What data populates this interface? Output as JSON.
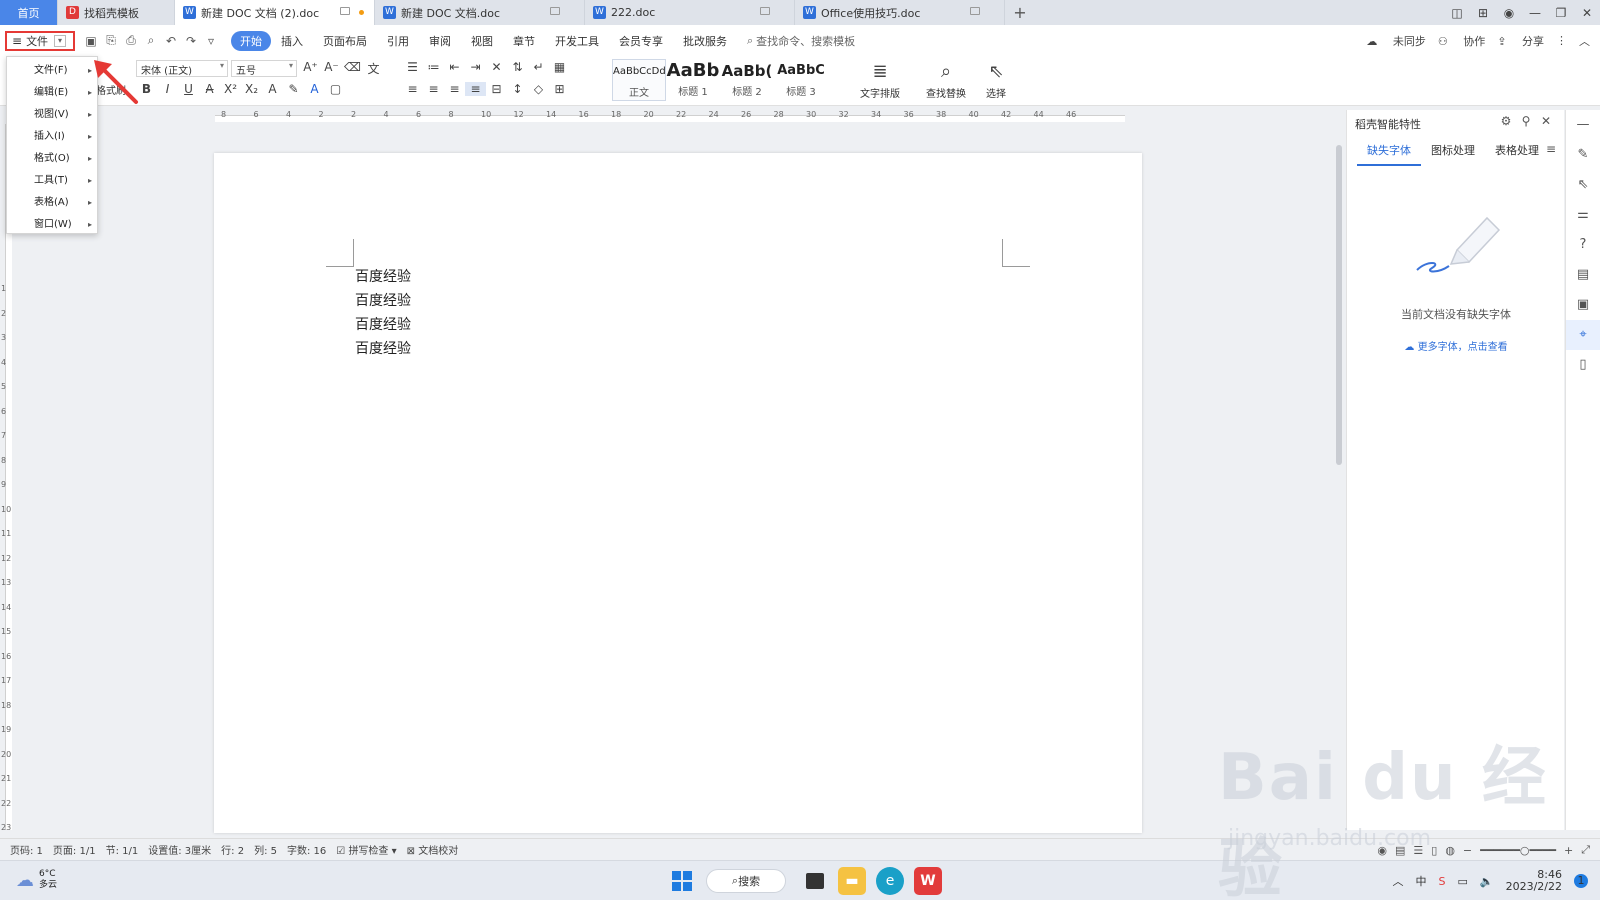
{
  "tabs": [
    {
      "label": "首页"
    },
    {
      "label": "找稻壳模板"
    },
    {
      "label": "新建 DOC 文档 (2).doc"
    },
    {
      "label": "新建 DOC 文档.doc"
    },
    {
      "label": "222.doc"
    },
    {
      "label": "Office使用技巧.doc"
    }
  ],
  "menu": {
    "file_label": "文件",
    "tabs": [
      "开始",
      "插入",
      "页面布局",
      "引用",
      "审阅",
      "视图",
      "章节",
      "开发工具",
      "会员专享",
      "批改服务"
    ],
    "search_placeholder": "查找命令、搜索模板",
    "unsync": "未同步",
    "collab": "协作",
    "share": "分享"
  },
  "ribbon": {
    "font_name": "宋体 (正文)",
    "font_size": "五号",
    "format_brush": "格式刷",
    "styles": [
      {
        "sample": "AaBbCcDd",
        "name": "正文"
      },
      {
        "sample": "AaBb",
        "name": "标题 1"
      },
      {
        "sample": "AaBb(",
        "name": "标题 2"
      },
      {
        "sample": "AaBbC",
        "name": "标题 3"
      }
    ],
    "text_layout": "文字排版",
    "find_replace": "查找替换",
    "select": "选择"
  },
  "ruler_numbers": [
    "8",
    "6",
    "4",
    "2",
    "2",
    "4",
    "6",
    "8",
    "10",
    "12",
    "14",
    "16",
    "18",
    "20",
    "22",
    "24",
    "26",
    "28",
    "30",
    "32",
    "34",
    "36",
    "38",
    "40",
    "42",
    "44",
    "46"
  ],
  "vruler_numbers": [
    "1",
    "2",
    "3",
    "4",
    "5",
    "6",
    "7",
    "8",
    "9",
    "10",
    "11",
    "12",
    "13",
    "14",
    "15",
    "16",
    "17",
    "18",
    "19",
    "20",
    "21",
    "22",
    "23"
  ],
  "dropdown_items": [
    "文件(F)",
    "编辑(E)",
    "视图(V)",
    "插入(I)",
    "格式(O)",
    "工具(T)",
    "表格(A)",
    "窗口(W)"
  ],
  "document": {
    "lines": [
      "百度经验",
      "百度经验",
      "百度经验",
      "百度经验"
    ]
  },
  "panel": {
    "title": "稻壳智能特性",
    "tabs": [
      "缺失字体",
      "图标处理",
      "表格处理"
    ],
    "empty_text": "当前文档没有缺失字体",
    "more_link": "更多字体，点击查看"
  },
  "status": {
    "page_no": "页码: 1",
    "page": "页面: 1/1",
    "section": "节: 1/1",
    "setting": "设置值: 3厘米",
    "row": "行: 2",
    "col": "列: 5",
    "words": "字数: 16",
    "spell": "拼写检查",
    "proof": "文档校对"
  },
  "taskbar": {
    "temp": "6°C",
    "weather": "多云",
    "search": "搜索",
    "time": "8:46",
    "date": "2023/2/22",
    "notif_count": "1"
  },
  "watermark": {
    "brand": "Bai du 经验",
    "site": "jingyan.baidu.com"
  }
}
